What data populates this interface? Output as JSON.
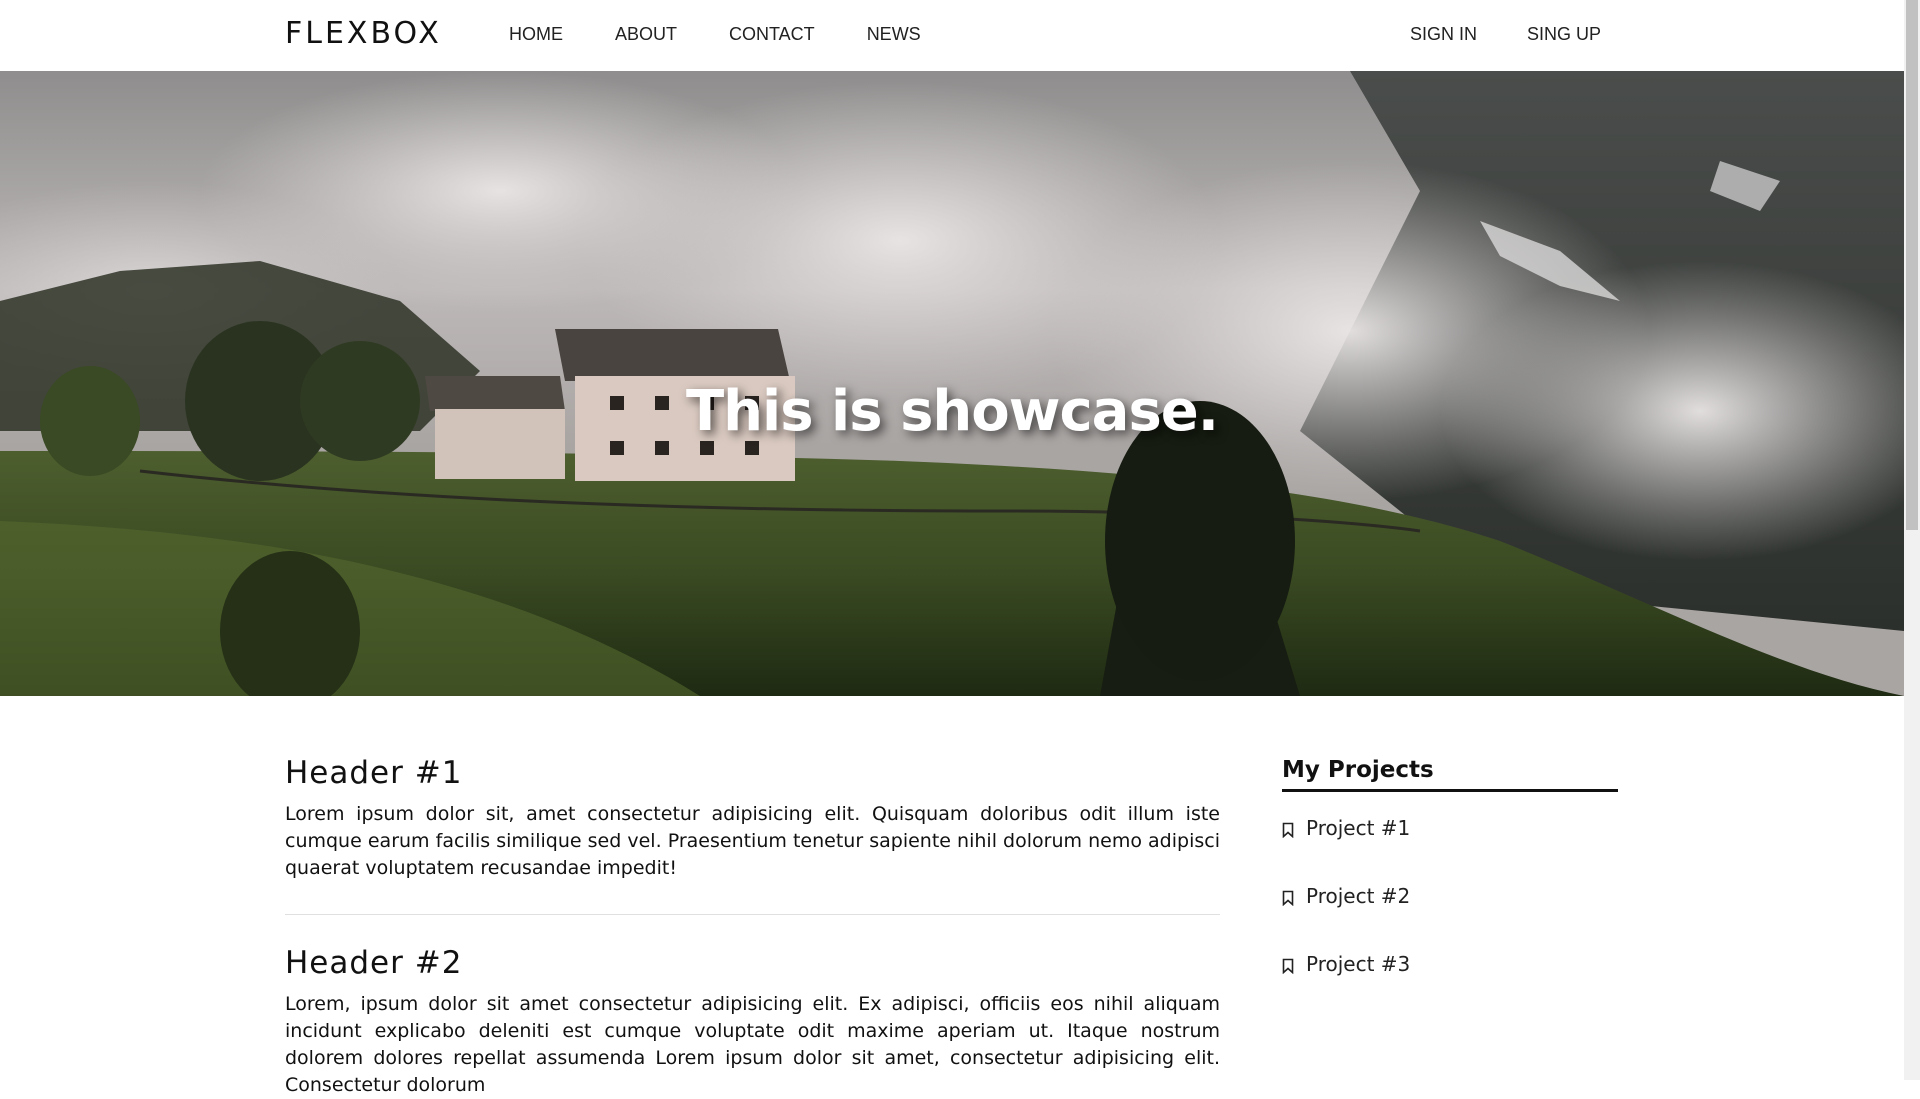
{
  "navbar": {
    "brand": "FLEXBOX",
    "left_links": [
      "HOME",
      "ABOUT",
      "CONTACT",
      "NEWS"
    ],
    "right_links": [
      "SIGN IN",
      "SING UP"
    ]
  },
  "showcase": {
    "title": "This is showcase."
  },
  "articles": [
    {
      "header": "Header #1",
      "body": "Lorem ipsum dolor sit, amet consectetur adipisicing elit. Quisquam doloribus odit illum iste cumque earum facilis similique sed vel. Praesentium tenetur sapiente nihil dolorum nemo adipisci quaerat voluptatem recusandae impedit!"
    },
    {
      "header": "Header #2",
      "body": "Lorem, ipsum dolor sit amet consectetur adipisicing elit. Ex adipisci, officiis eos nihil aliquam incidunt explicabo deleniti est cumque voluptate odit maxime aperiam ut. Itaque nostrum dolorem dolores repellat assumenda Lorem ipsum dolor sit amet, consectetur adipisicing elit. Consectetur dolorum"
    }
  ],
  "sidebar": {
    "title": "My Projects",
    "projects": [
      "Project #1",
      "Project #2",
      "Project #3"
    ],
    "icon": "bookmark-icon"
  },
  "colors": {
    "text": "#111111",
    "background": "#ffffff",
    "showcase_title": "#ffffff"
  }
}
